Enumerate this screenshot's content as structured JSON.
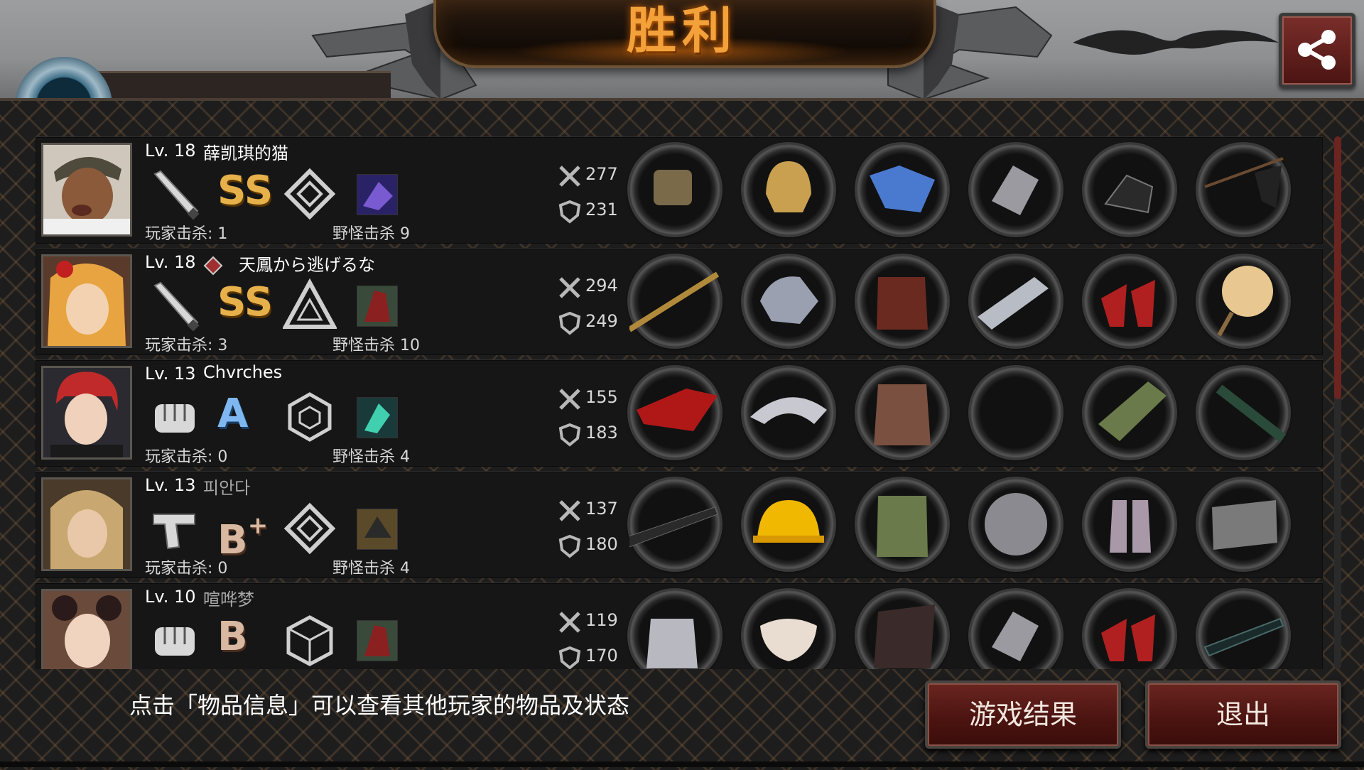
{
  "header": {
    "title": "胜利",
    "share_icon": "share-icon"
  },
  "players": [
    {
      "level": "Lv. 18",
      "name": "薛凯琪的猫",
      "name_dim": false,
      "weapon_icon": "bat-icon",
      "grade": "SS",
      "grade_plus": "",
      "grade_color": "gold",
      "rank_icon": "diamond-rank-icon",
      "player_kills": "玩家击杀: 1",
      "monster_kills": "野怪击杀 9",
      "attack": "277",
      "defense": "231",
      "equipment": [
        "gauntlet",
        "golden-helmet",
        "blue-outfit",
        "spiked-armguard",
        "black-boots",
        "flag"
      ]
    },
    {
      "level": "Lv. 18",
      "name": "天鳳から逃げるな",
      "name_dim": false,
      "weapon_icon": "bat-icon",
      "grade": "SS",
      "grade_plus": "",
      "grade_color": "gold",
      "rank_icon": "triangle-rank-icon",
      "player_kills": "玩家击杀: 3",
      "monster_kills": "野怪击杀 10",
      "attack": "294",
      "defense": "249",
      "equipment": [
        "scepter",
        "mecha-helmet",
        "red-jacket",
        "silver-armguard",
        "red-heels",
        "hand-fan"
      ]
    },
    {
      "level": "Lv. 13",
      "name": "Chvrches",
      "name_dim": false,
      "weapon_icon": "fist-icon",
      "grade": "A",
      "grade_plus": "",
      "grade_color": "blue",
      "rank_icon": "hexagon-rank-icon",
      "player_kills": "玩家击杀: 0",
      "monster_kills": "野怪击杀 4",
      "attack": "155",
      "defense": "183",
      "equipment": [
        "red-claw",
        "tiara",
        "battle-armor",
        "",
        "bracer",
        "baton"
      ]
    },
    {
      "level": "Lv. 13",
      "name": "피안다",
      "name_dim": true,
      "weapon_icon": "pistol-icon",
      "grade": "B",
      "grade_plus": "+",
      "grade_color": "tan",
      "rank_icon": "diamond-rank-icon",
      "player_kills": "玩家击杀: 0",
      "monster_kills": "野怪击杀 4",
      "attack": "137",
      "defense": "180",
      "equipment": [
        "sniper-rifle",
        "hard-hat",
        "camo-vest",
        "steel-plate",
        "boots",
        "magazine"
      ]
    },
    {
      "level": "Lv. 10",
      "name": "喧哗梦",
      "name_dim": true,
      "weapon_icon": "fist-icon",
      "grade": "B",
      "grade_plus": "",
      "grade_color": "tan",
      "rank_icon": "cube-rank-icon",
      "player_kills": "",
      "monster_kills": "",
      "attack": "119",
      "defense": "170",
      "equipment": [
        "steel-gauntlet",
        "mask",
        "coat",
        "spiked-armguard",
        "red-heels",
        "scope"
      ]
    }
  ],
  "footer": {
    "hint": "点击「物品信息」可以查看其他玩家的物品及状态",
    "results_button": "游戏结果",
    "exit_button": "退出"
  },
  "colors": {
    "title_orange": "#f3a13a",
    "button_red": "#5a1a16",
    "grade_gold": "#e6b04a",
    "grade_blue": "#7fb8f0"
  }
}
